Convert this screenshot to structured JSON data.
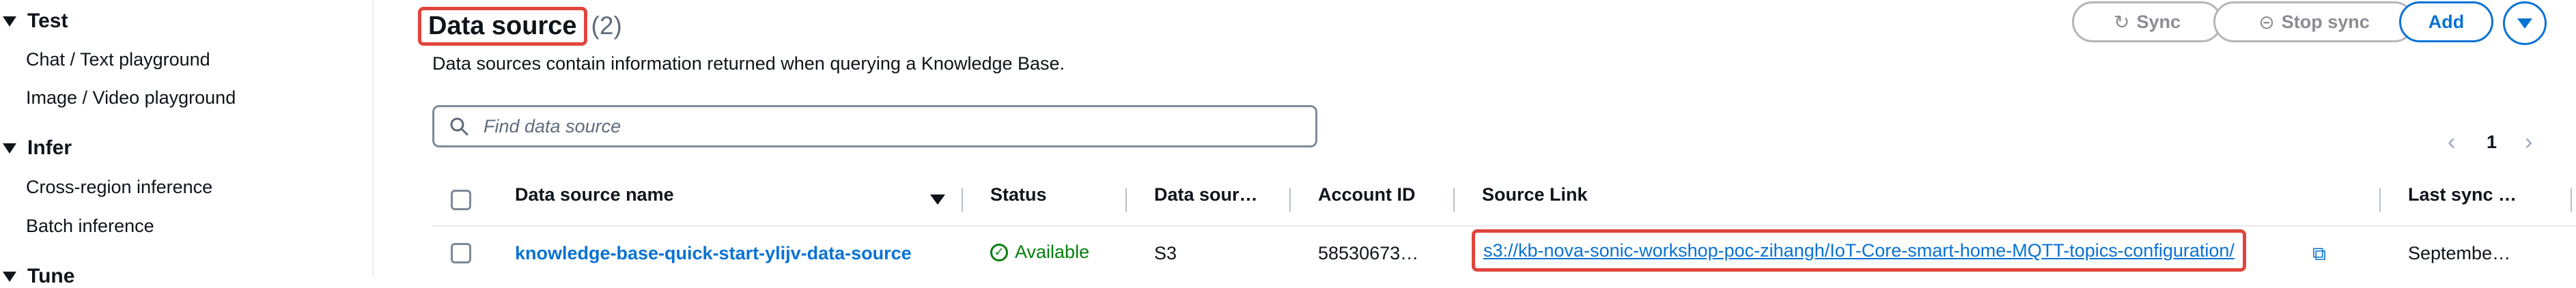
{
  "sidebar": {
    "sections": [
      {
        "label": "Test",
        "items": [
          {
            "label": "Chat / Text playground"
          },
          {
            "label": "Image / Video playground"
          }
        ]
      },
      {
        "label": "Infer",
        "items": [
          {
            "label": "Cross-region inference"
          },
          {
            "label": "Batch inference"
          }
        ]
      },
      {
        "label": "Tune",
        "items": []
      }
    ]
  },
  "header": {
    "title": "Data source",
    "count": "(2)",
    "description": "Data sources contain information returned when querying a Knowledge Base.",
    "buttons": {
      "sync": "Sync",
      "stop_sync": "Stop sync",
      "add": "Add"
    }
  },
  "search": {
    "placeholder": "Find data source"
  },
  "pagination": {
    "current_page": "1"
  },
  "table": {
    "columns": [
      "Data source name",
      "Status",
      "Data sour…",
      "Account ID",
      "Source Link",
      "Last sync …"
    ],
    "rows": [
      {
        "name": "knowledge-base-quick-start-ylijv-data-source",
        "status": "Available",
        "type": "S3",
        "account_id": "58530673…",
        "source_link": "s3://kb-nova-sonic-workshop-poc-zihangh/IoT-Core-smart-home-MQTT-topics-configuration/",
        "last_sync": "Septembe…"
      }
    ]
  },
  "colors": {
    "accent": "#0972d3",
    "success": "#037f0c",
    "highlight": "#e0453d",
    "disabled": "#8c8c94"
  }
}
